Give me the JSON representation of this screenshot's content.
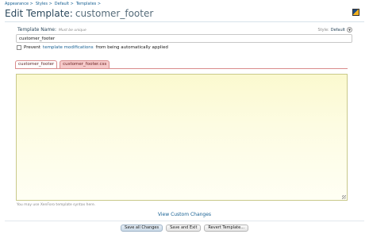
{
  "breadcrumb": [
    {
      "label": "Appearance >"
    },
    {
      "label": "Styles >"
    },
    {
      "label": "Default >"
    },
    {
      "label": "Templates >"
    }
  ],
  "page_title": {
    "label": "Edit Template:",
    "value": "customer_footer"
  },
  "template_name": {
    "label": "Template Name:",
    "hint": "Must be unique",
    "value": "customer_footer"
  },
  "style": {
    "label": "Style:",
    "value": "Default"
  },
  "prevent": {
    "prefix": "Prevent",
    "link": "template modifications",
    "suffix": "from being automatically applied",
    "checked": false
  },
  "tabs": [
    {
      "label": "customer_footer",
      "active": true
    },
    {
      "label": "customer_footer.css",
      "active": false
    }
  ],
  "editor": {
    "content": ""
  },
  "syntax_note": "You may use XenForo template syntax here.",
  "view_custom_changes": "View Custom Changes",
  "buttons": {
    "save_all": "Save all Changes",
    "save_exit": "Save and Exit",
    "revert": "Revert Template..."
  }
}
